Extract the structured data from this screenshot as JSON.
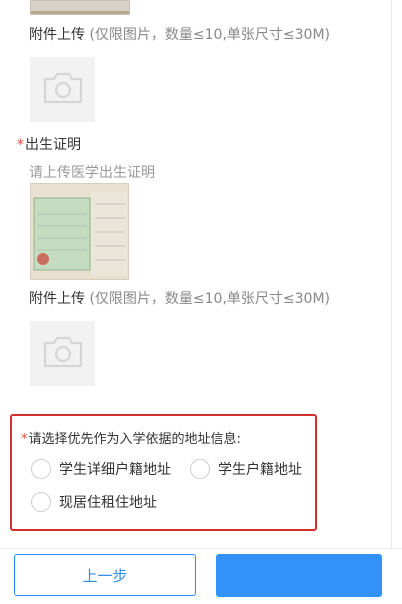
{
  "upload_note": {
    "label": "附件上传",
    "hint": " (仅限图片，数量≤10,单张尺寸≤30M)"
  },
  "birth_certificate": {
    "required_mark": "*",
    "title": "出生证明",
    "hint": "请上传医学出生证明"
  },
  "address_choice": {
    "required_mark": "*",
    "title": "请选择优先作为入学依据的地址信息:",
    "options": [
      "学生详细户籍地址",
      "学生户籍地址",
      "现居住租住地址"
    ]
  },
  "footer": {
    "prev_label": "上一步",
    "next_label": ""
  },
  "colors": {
    "primary": "#3392f8",
    "required": "#e74c3c",
    "highlight_border": "#d32f2f"
  }
}
